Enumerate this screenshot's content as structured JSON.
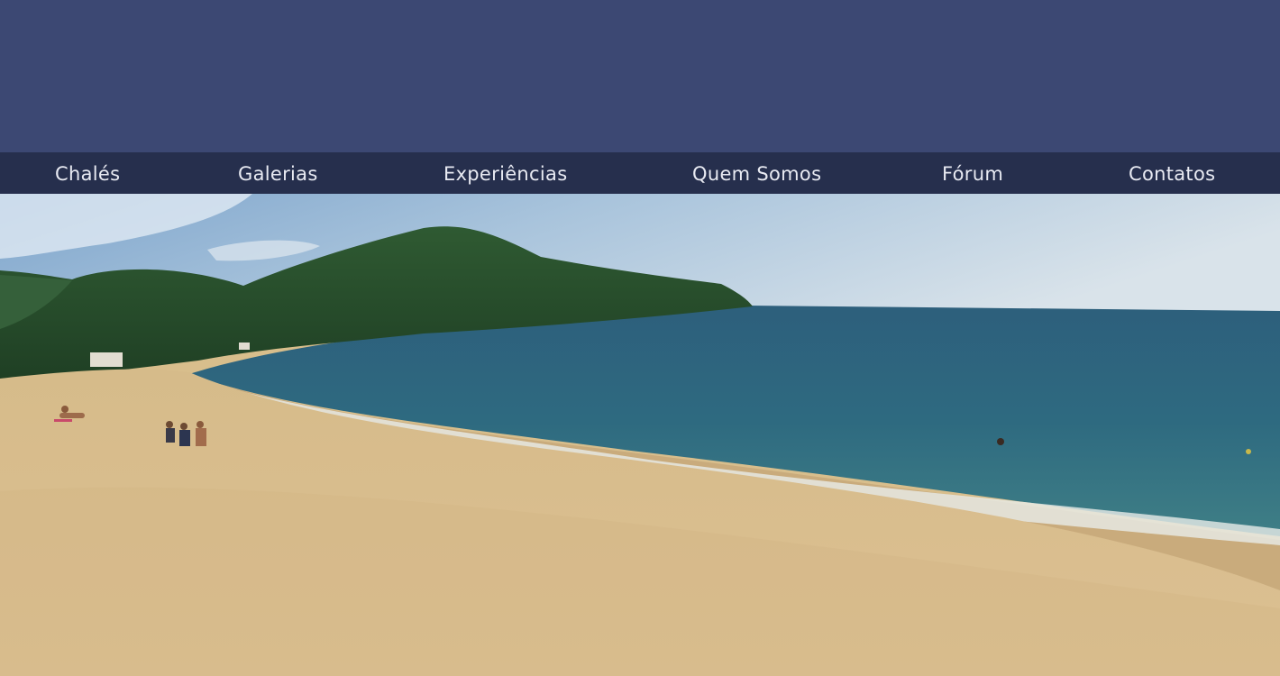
{
  "nav": {
    "items": [
      {
        "label": "Chalés"
      },
      {
        "label": "Galerias"
      },
      {
        "label": "Experiências"
      },
      {
        "label": "Quem Somos"
      },
      {
        "label": "Fórum"
      },
      {
        "label": "Contatos"
      }
    ]
  },
  "colors": {
    "header_bg": "#3c4873",
    "nav_bg": "#262f4d",
    "nav_text": "#e8eaf2"
  },
  "hero": {
    "subject": "beach-panorama-photo"
  }
}
